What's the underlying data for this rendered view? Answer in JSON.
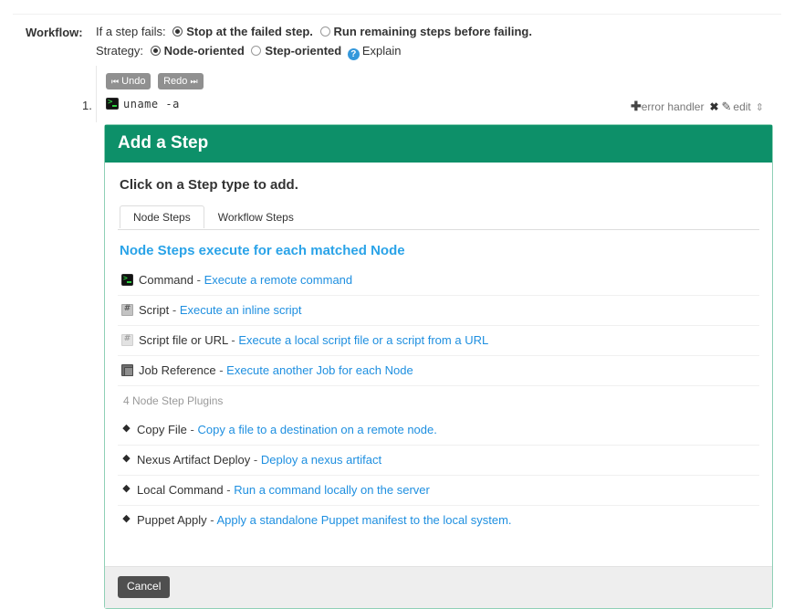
{
  "form": {
    "label": "Workflow:",
    "failure": {
      "lead": "If a step fails:",
      "option_stop": "Stop at the failed step.",
      "option_run": "Run remaining steps before failing.",
      "selected": "stop"
    },
    "strategy": {
      "lead": "Strategy:",
      "option_node": "Node-oriented",
      "option_step": "Step-oriented",
      "selected": "node",
      "help_icon": "question-circle-icon",
      "explain_label": "Explain"
    }
  },
  "toolbar": {
    "undo_label": "Undo",
    "undo_icon": "⏮",
    "redo_label": "Redo",
    "redo_icon": "⏭"
  },
  "step": {
    "number": "1.",
    "icon": "terminal-icon",
    "command": "uname -a",
    "actions": {
      "add_error_handler": "error handler",
      "plus_icon": "✚",
      "remove_icon": "✖",
      "edit_icon": "✎",
      "edit_label": "edit",
      "reorder_icon": "⇕"
    }
  },
  "dialog": {
    "title": "Add a Step",
    "intro": "Click on a Step type to add.",
    "accent_color": "#0d9069",
    "border_color": "#8fd0b6",
    "link_color": "#1e8fe0",
    "tabs": [
      {
        "label": "Node Steps",
        "active": true
      },
      {
        "label": "Workflow Steps",
        "active": false
      }
    ],
    "section_title": "Node Steps execute for each matched Node",
    "builtin_steps": [
      {
        "icon": "terminal-icon",
        "name": "Command",
        "dash": "-",
        "desc": "Execute a remote command"
      },
      {
        "icon": "script-icon",
        "name": "Script",
        "dash": "-",
        "desc": "Execute an inline script"
      },
      {
        "icon": "script-file-icon",
        "name": "Script file or URL",
        "dash": "-",
        "desc": "Execute a local script file or a script from a URL"
      },
      {
        "icon": "job-reference-icon",
        "name": "Job Reference",
        "dash": "-",
        "desc": "Execute another Job for each Node"
      }
    ],
    "plugins_heading": "4 Node Step Plugins",
    "plugin_steps": [
      {
        "icon": "gem-icon",
        "name": "Copy File",
        "dash": "-",
        "desc": "Copy a file to a destination on a remote node."
      },
      {
        "icon": "gem-icon",
        "name": "Nexus Artifact Deploy",
        "dash": "-",
        "desc": "Deploy a nexus artifact"
      },
      {
        "icon": "gem-icon",
        "name": "Local Command",
        "dash": "-",
        "desc": "Run a command locally on the server"
      },
      {
        "icon": "gem-icon",
        "name": "Puppet Apply",
        "dash": "-",
        "desc": "Apply a standalone Puppet manifest to the local system."
      }
    ],
    "cancel_label": "Cancel"
  }
}
